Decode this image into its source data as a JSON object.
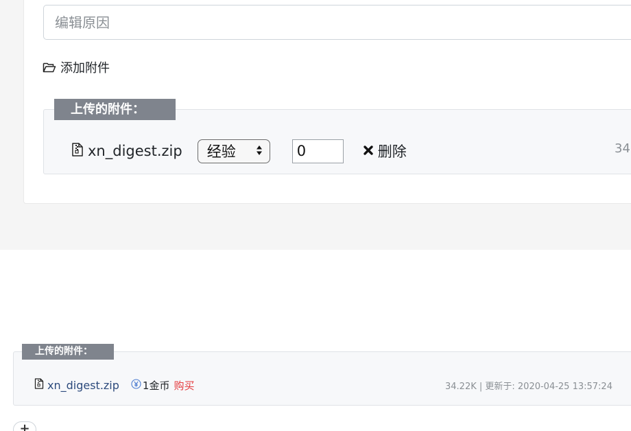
{
  "edit_form": {
    "reason_placeholder": "编辑原因",
    "add_attachment_label": "添加附件"
  },
  "upload_panel": {
    "legend": "上传的附件：",
    "file": {
      "icon": "zip-file-icon",
      "name": "xn_digest.zip",
      "type_selected": "经验",
      "amount_value": "0",
      "delete_label": "删除",
      "size_text": "34"
    }
  },
  "attachment_panel": {
    "legend": "上传的附件：",
    "file": {
      "icon": "zip-file-icon",
      "name": "xn_digest.zip",
      "coin_icon": "yen-circle-icon",
      "price": "1金币",
      "buy_label": "购买",
      "meta": "34.22K | 更新于: 2020-04-25 13:57:24"
    }
  },
  "toolbar": {
    "plus_label": "+"
  },
  "colors": {
    "legend_bg": "#7f848d",
    "buy": "#e4393c",
    "link": "#2c4a7c",
    "coin": "#4a7bd0"
  }
}
